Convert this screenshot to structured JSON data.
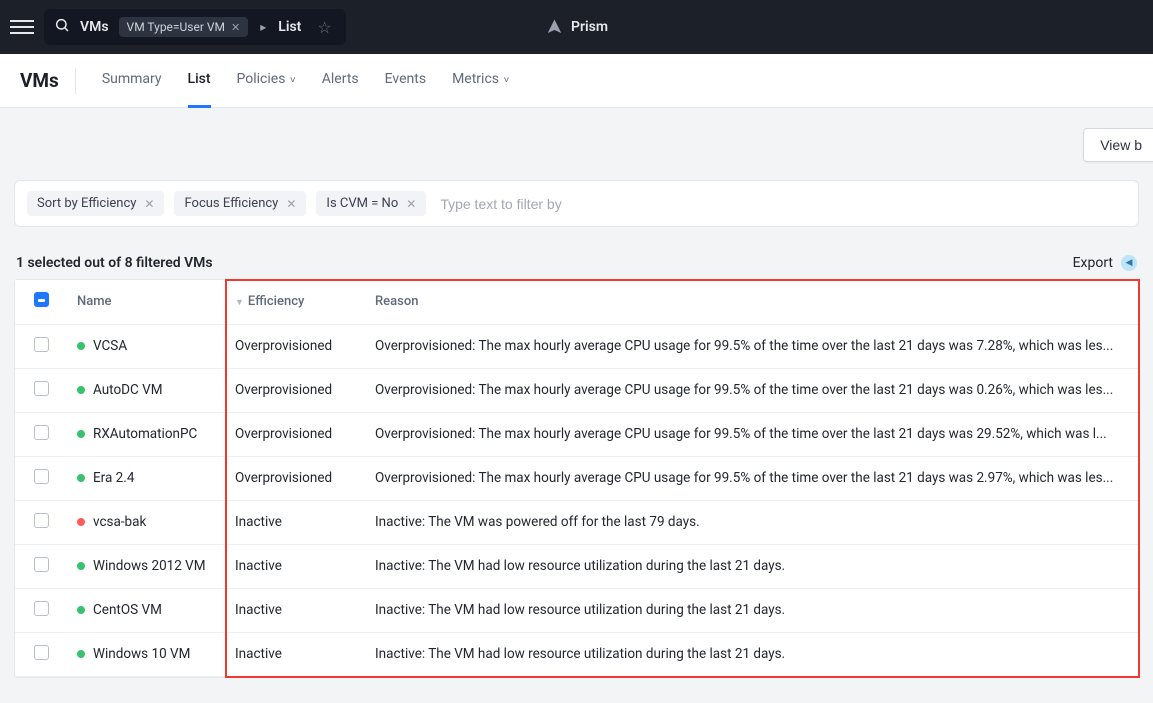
{
  "brand": "Prism",
  "breadcrumb": {
    "root": "VMs",
    "chip": "VM Type=User VM",
    "leaf": "List"
  },
  "page_title": "VMs",
  "tabs": [
    {
      "label": "Summary",
      "has_caret": false,
      "active": false
    },
    {
      "label": "List",
      "has_caret": false,
      "active": true
    },
    {
      "label": "Policies",
      "has_caret": true,
      "active": false
    },
    {
      "label": "Alerts",
      "has_caret": false,
      "active": false
    },
    {
      "label": "Events",
      "has_caret": false,
      "active": false
    },
    {
      "label": "Metrics",
      "has_caret": true,
      "active": false
    }
  ],
  "action_button": "View b",
  "filters": [
    {
      "label": "Sort by Efficiency"
    },
    {
      "label": "Focus Efficiency"
    },
    {
      "label": "Is CVM = No"
    }
  ],
  "filter_placeholder": "Type text to filter by",
  "selection_text": "1 selected out of 8 filtered VMs",
  "export_label": "Export",
  "columns": {
    "name": "Name",
    "efficiency": "Efficiency",
    "reason": "Reason"
  },
  "rows": [
    {
      "status": "green",
      "name": "VCSA",
      "efficiency": "Overprovisioned",
      "reason": "Overprovisioned: The max hourly average CPU usage for 99.5% of the time over the last 21 days was 7.28%, which was les..."
    },
    {
      "status": "green",
      "name": "AutoDC VM",
      "efficiency": "Overprovisioned",
      "reason": "Overprovisioned: The max hourly average CPU usage for 99.5% of the time over the last 21 days was 0.26%, which was les..."
    },
    {
      "status": "green",
      "name": "RXAutomationPC",
      "efficiency": "Overprovisioned",
      "reason": "Overprovisioned: The max hourly average CPU usage for 99.5% of the time over the last 21 days was 29.52%, which was l..."
    },
    {
      "status": "green",
      "name": "Era 2.4",
      "efficiency": "Overprovisioned",
      "reason": "Overprovisioned: The max hourly average CPU usage for 99.5% of the time over the last 21 days was 2.97%, which was les..."
    },
    {
      "status": "red",
      "name": "vcsa-bak",
      "efficiency": "Inactive",
      "reason": "Inactive: The VM was powered off for the last 79 days."
    },
    {
      "status": "green",
      "name": "Windows 2012 VM",
      "efficiency": "Inactive",
      "reason": "Inactive: The VM had low resource utilization during the last 21 days."
    },
    {
      "status": "green",
      "name": "CentOS VM",
      "efficiency": "Inactive",
      "reason": "Inactive: The VM had low resource utilization during the last 21 days."
    },
    {
      "status": "green",
      "name": "Windows 10 VM",
      "efficiency": "Inactive",
      "reason": "Inactive: The VM had low resource utilization during the last 21 days."
    }
  ]
}
